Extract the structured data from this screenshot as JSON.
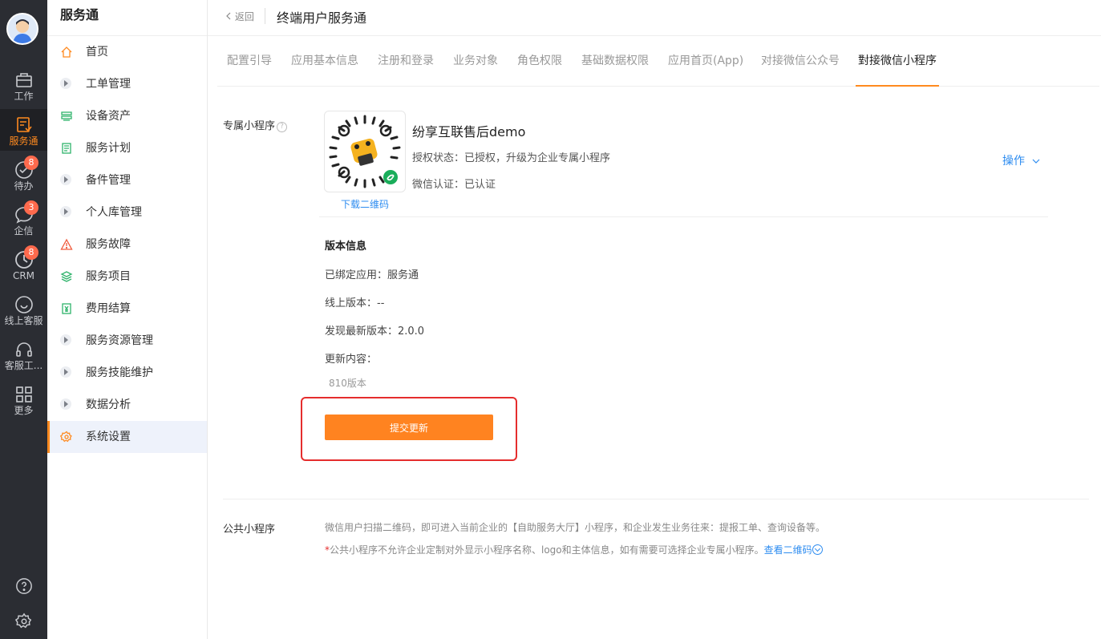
{
  "rail": {
    "items": [
      {
        "label": "工作",
        "icon": "briefcase-icon"
      },
      {
        "label": "服务通",
        "icon": "service-icon",
        "active": true
      },
      {
        "label": "待办",
        "icon": "check-circle-icon",
        "badge": "8"
      },
      {
        "label": "企信",
        "icon": "chat-bubble-icon",
        "badge": "3"
      },
      {
        "label": "CRM",
        "icon": "clock-icon",
        "badge": "8"
      },
      {
        "label": "线上客服",
        "icon": "smile-icon"
      },
      {
        "label": "客服工...",
        "icon": "headset-icon"
      },
      {
        "label": "更多",
        "icon": "grid-icon"
      }
    ],
    "accent": "#ff8a1f"
  },
  "sidebar": {
    "title": "服务通",
    "items": [
      {
        "label": "首页",
        "icon": "home-icon"
      },
      {
        "label": "工单管理",
        "icon": "expand-icon"
      },
      {
        "label": "设备资产",
        "icon": "device-icon"
      },
      {
        "label": "服务计划",
        "icon": "plan-icon"
      },
      {
        "label": "备件管理",
        "icon": "expand-icon"
      },
      {
        "label": "个人库管理",
        "icon": "expand-icon"
      },
      {
        "label": "服务故障",
        "icon": "warning-icon"
      },
      {
        "label": "服务项目",
        "icon": "layers-icon"
      },
      {
        "label": "费用结算",
        "icon": "yen-icon"
      },
      {
        "label": "服务资源管理",
        "icon": "expand-icon"
      },
      {
        "label": "服务技能维护",
        "icon": "expand-icon"
      },
      {
        "label": "数据分析",
        "icon": "expand-icon"
      },
      {
        "label": "系统设置",
        "icon": "gear-icon",
        "active": true
      }
    ]
  },
  "topbar": {
    "back_label": "返回",
    "title": "终端用户服务通"
  },
  "tabs": [
    {
      "label": "配置引导"
    },
    {
      "label": "应用基本信息"
    },
    {
      "label": "注册和登录"
    },
    {
      "label": "业务对象"
    },
    {
      "label": "角色权限"
    },
    {
      "label": "基础数据权限"
    },
    {
      "label": "应用首页(App)"
    },
    {
      "label": "对接微信公众号"
    },
    {
      "label": "對接微信小程序",
      "active": true
    }
  ],
  "exclusive": {
    "label": "专属小程序",
    "help": "?",
    "download_label": "下载二维码",
    "name": "纷享互联售后demo",
    "auth_status": "授权状态：已授权，升级为企业专属小程序",
    "wechat_cert": "微信认证：已认证",
    "operation_label": "操作"
  },
  "version": {
    "title": "版本信息",
    "bound_app": "已绑定应用：服务通",
    "online_version": "线上版本：--",
    "latest_version": "发现最新版本：2.0.0",
    "update_content_label": "更新内容：",
    "update_note": "810版本",
    "submit_label": "提交更新"
  },
  "public": {
    "label": "公共小程序",
    "desc": "微信用户扫描二维码，即可进入当前企业的【自助服务大厅】小程序，和企业发生业务往来：提报工单、查询设备等。",
    "star": "*",
    "note": "公共小程序不允许企业定制对外显示小程序名称、logo和主体信息，如有需要可选择企业专属小程序。",
    "view_qr_label": "查看二维码"
  }
}
